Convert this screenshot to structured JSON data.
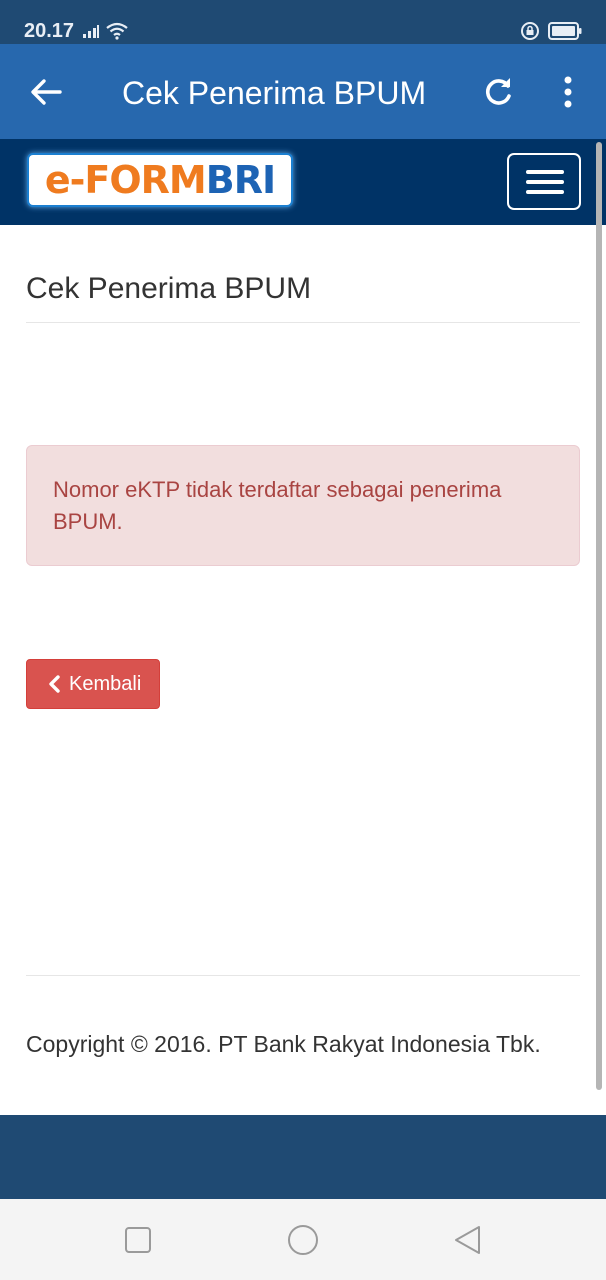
{
  "status_bar": {
    "time": "20.17",
    "icons": [
      "signal-icon",
      "wifi-icon",
      "lock-rotation-icon",
      "battery-icon"
    ]
  },
  "app_bar": {
    "title": "Cek Penerima BPUM",
    "icons": [
      "back-arrow-icon",
      "refresh-icon",
      "more-vertical-icon"
    ]
  },
  "site_nav": {
    "logo": "e-FORMBRI",
    "toggle_icon": "hamburger-icon"
  },
  "main": {
    "heading": "Cek Penerima BPUM",
    "alert": "Nomor eKTP tidak terdaftar sebagai penerima BPUM.",
    "back_button": "Kembali"
  },
  "footer": {
    "copyright": "Copyright © 2016. PT Bank Rakyat Indonesia Tbk."
  },
  "android_nav": {
    "icons": [
      "recents-square-icon",
      "home-circle-icon",
      "back-triangle-icon"
    ]
  },
  "colors": {
    "status_bar": "#1f4a73",
    "app_bar": "#2768ae",
    "site_nav": "#003366",
    "alert_bg": "#f2dede",
    "alert_text": "#a94442",
    "danger_button": "#d9534f"
  }
}
